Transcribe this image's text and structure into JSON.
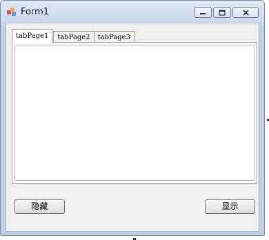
{
  "window": {
    "title": "Form1",
    "caption_buttons": [
      {
        "name": "minimize-button",
        "icon": "minimize-icon"
      },
      {
        "name": "maximize-button",
        "icon": "maximize-icon"
      },
      {
        "name": "close-button",
        "icon": "close-icon"
      }
    ],
    "colors": {
      "titlebar": "#c9d8ec",
      "client_bg": "#f0f0f0",
      "panel_bg": "#ffffff"
    }
  },
  "tabs": [
    {
      "label": "tabPage1",
      "active": true
    },
    {
      "label": "tabPage2",
      "active": false
    },
    {
      "label": "tabPage3",
      "active": false
    }
  ],
  "buttons": {
    "hide_label": "隐藏",
    "show_label": "显示"
  }
}
